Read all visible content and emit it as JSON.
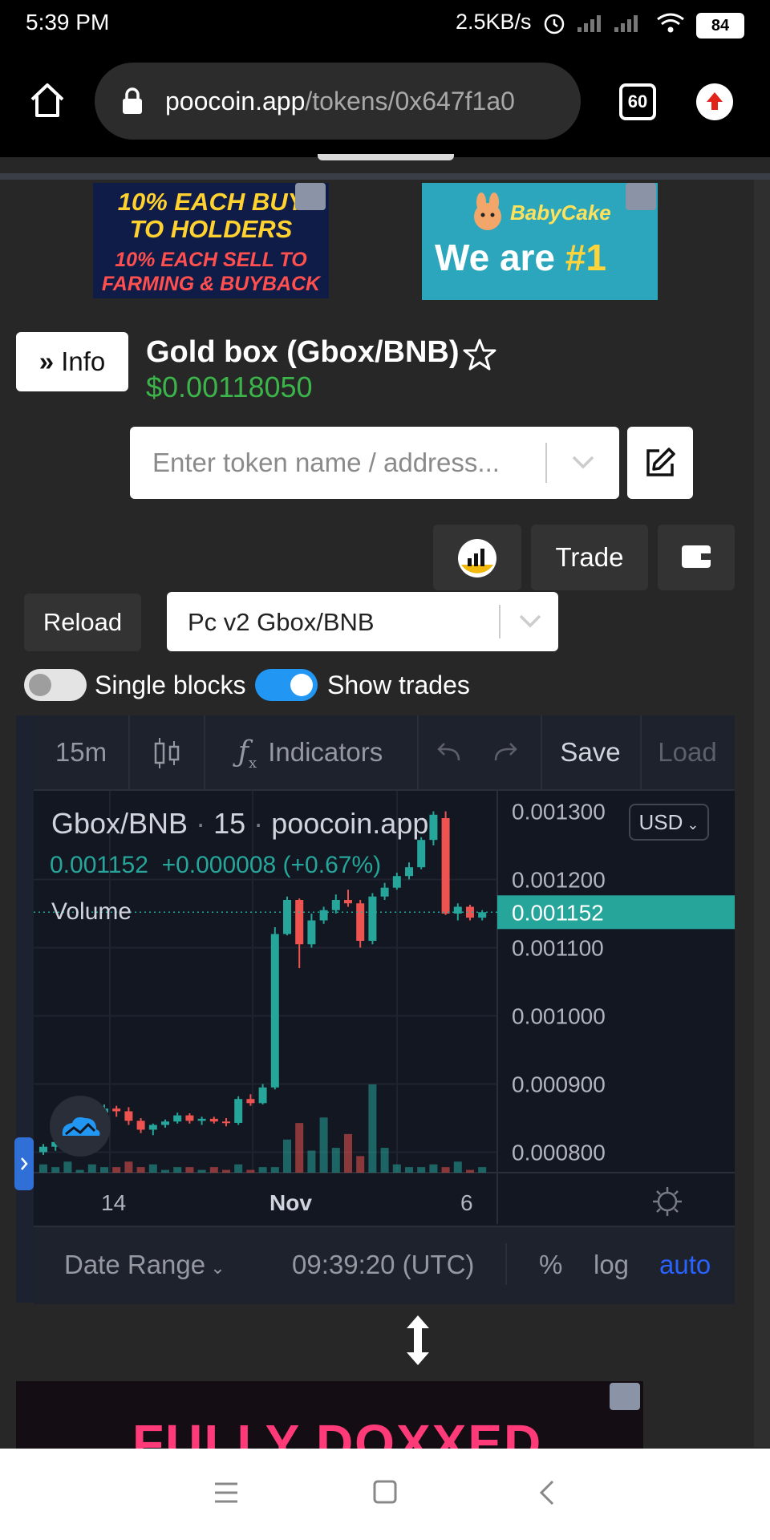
{
  "status_bar": {
    "time": "5:39 PM",
    "net_speed": "2.5KB/s",
    "battery": "84"
  },
  "browser": {
    "url_host": "poocoin.app",
    "url_path": "/tokens/0x647f1a0",
    "tab_count": "60"
  },
  "ads": {
    "top_left": [
      "10% EACH BUY",
      "TO HOLDERS",
      "10% EACH SELL TO",
      "FARMING & BUYBACK"
    ],
    "top_right": {
      "brand": "BabyCake",
      "tagline": "We are ",
      "tagline_highlight": "#1"
    },
    "bottom": "FULLY DOXXED"
  },
  "token": {
    "info_label": "Info",
    "title": "Gold box (Gbox/BNB)",
    "price": "$0.00118050"
  },
  "search": {
    "placeholder": "Enter token name / address..."
  },
  "toolbar": {
    "trade_label": "Trade",
    "reload_label": "Reload",
    "pair_value": "Pc v2 Gbox/BNB"
  },
  "toggles": {
    "single_blocks": {
      "label": "Single blocks",
      "on": false
    },
    "show_trades": {
      "label": "Show trades",
      "on": true
    }
  },
  "chart_toolbar": {
    "interval": "15m",
    "indicators": "Indicators",
    "save": "Save",
    "load": "Load"
  },
  "chart_legend": {
    "symbol": "Gbox/BNB",
    "sep": "·",
    "interval": "15",
    "source": "poocoin.app",
    "ohlc_text": "0.001152  +0.000008 (+0.67%)",
    "volume_label": "Volume",
    "currency": "USD"
  },
  "chart_footer": {
    "date_range": "Date Range",
    "clock": "09:39:20 (UTC)",
    "percent": "%",
    "log": "log",
    "auto": "auto"
  },
  "colors": {
    "up": "#26a69a",
    "down": "#ef5350",
    "accent": "#2962ff"
  },
  "chart_data": {
    "type": "candlestick",
    "y_ticks": [
      "0.001200",
      "0.001100",
      "0.001000",
      "0.000900",
      "0.000800"
    ],
    "top_tick_partial": "0.001300",
    "x_ticks": [
      "14",
      "Nov",
      "6"
    ],
    "last_price_label": "0.001152",
    "ylim": [
      0.00077,
      0.00133
    ],
    "candles": [
      {
        "o": 0.0008,
        "h": 0.000812,
        "l": 0.000796,
        "c": 0.000808
      },
      {
        "o": 0.000808,
        "h": 0.000822,
        "l": 0.000802,
        "c": 0.000815
      },
      {
        "o": 0.000815,
        "h": 0.00083,
        "l": 0.00081,
        "c": 0.000825
      },
      {
        "o": 0.000825,
        "h": 0.000845,
        "l": 0.00082,
        "c": 0.000838
      },
      {
        "o": 0.000838,
        "h": 0.000862,
        "l": 0.000835,
        "c": 0.000858
      },
      {
        "o": 0.000858,
        "h": 0.00087,
        "l": 0.000852,
        "c": 0.000864
      },
      {
        "o": 0.000864,
        "h": 0.000868,
        "l": 0.000852,
        "c": 0.00086
      },
      {
        "o": 0.00086,
        "h": 0.000866,
        "l": 0.00084,
        "c": 0.000846
      },
      {
        "o": 0.000846,
        "h": 0.00085,
        "l": 0.000828,
        "c": 0.000833
      },
      {
        "o": 0.000833,
        "h": 0.000842,
        "l": 0.000825,
        "c": 0.00084
      },
      {
        "o": 0.00084,
        "h": 0.000848,
        "l": 0.000836,
        "c": 0.000845
      },
      {
        "o": 0.000845,
        "h": 0.000858,
        "l": 0.000842,
        "c": 0.000854
      },
      {
        "o": 0.000854,
        "h": 0.000857,
        "l": 0.000842,
        "c": 0.000846
      },
      {
        "o": 0.000846,
        "h": 0.000852,
        "l": 0.00084,
        "c": 0.000849
      },
      {
        "o": 0.000849,
        "h": 0.000852,
        "l": 0.000842,
        "c": 0.000845
      },
      {
        "o": 0.000845,
        "h": 0.00085,
        "l": 0.000838,
        "c": 0.000843
      },
      {
        "o": 0.000843,
        "h": 0.000882,
        "l": 0.00084,
        "c": 0.000878
      },
      {
        "o": 0.000878,
        "h": 0.000885,
        "l": 0.000868,
        "c": 0.000872
      },
      {
        "o": 0.000872,
        "h": 0.0009,
        "l": 0.00087,
        "c": 0.000895
      },
      {
        "o": 0.000895,
        "h": 0.00113,
        "l": 0.000892,
        "c": 0.00112
      },
      {
        "o": 0.00112,
        "h": 0.001175,
        "l": 0.001118,
        "c": 0.00117
      },
      {
        "o": 0.00117,
        "h": 0.001172,
        "l": 0.00107,
        "c": 0.001105
      },
      {
        "o": 0.001105,
        "h": 0.00115,
        "l": 0.0011,
        "c": 0.00114
      },
      {
        "o": 0.00114,
        "h": 0.00116,
        "l": 0.001135,
        "c": 0.001155
      },
      {
        "o": 0.001155,
        "h": 0.001178,
        "l": 0.00115,
        "c": 0.00117
      },
      {
        "o": 0.00117,
        "h": 0.001185,
        "l": 0.00116,
        "c": 0.001165
      },
      {
        "o": 0.001165,
        "h": 0.00117,
        "l": 0.0011,
        "c": 0.00111
      },
      {
        "o": 0.00111,
        "h": 0.00118,
        "l": 0.001105,
        "c": 0.001175
      },
      {
        "o": 0.001175,
        "h": 0.001195,
        "l": 0.00117,
        "c": 0.001188
      },
      {
        "o": 0.001188,
        "h": 0.00121,
        "l": 0.001185,
        "c": 0.001205
      },
      {
        "o": 0.001205,
        "h": 0.001225,
        "l": 0.0012,
        "c": 0.001218
      },
      {
        "o": 0.001218,
        "h": 0.001262,
        "l": 0.001215,
        "c": 0.001258
      },
      {
        "o": 0.001258,
        "h": 0.0013,
        "l": 0.00125,
        "c": 0.001295
      },
      {
        "o": 0.00129,
        "h": 0.0013,
        "l": 0.001148,
        "c": 0.00115
      },
      {
        "o": 0.00115,
        "h": 0.001165,
        "l": 0.00114,
        "c": 0.00116
      },
      {
        "o": 0.00116,
        "h": 0.001163,
        "l": 0.00114,
        "c": 0.001144
      },
      {
        "o": 0.001144,
        "h": 0.001155,
        "l": 0.00114,
        "c": 0.001152
      }
    ],
    "volumes": [
      3,
      2,
      4,
      1,
      3,
      2,
      2,
      4,
      2,
      3,
      1,
      2,
      2,
      1,
      2,
      1,
      3,
      1,
      2,
      2,
      12,
      18,
      8,
      20,
      9,
      14,
      6,
      32,
      9,
      3,
      2,
      2,
      3,
      2,
      4,
      1,
      2
    ]
  }
}
